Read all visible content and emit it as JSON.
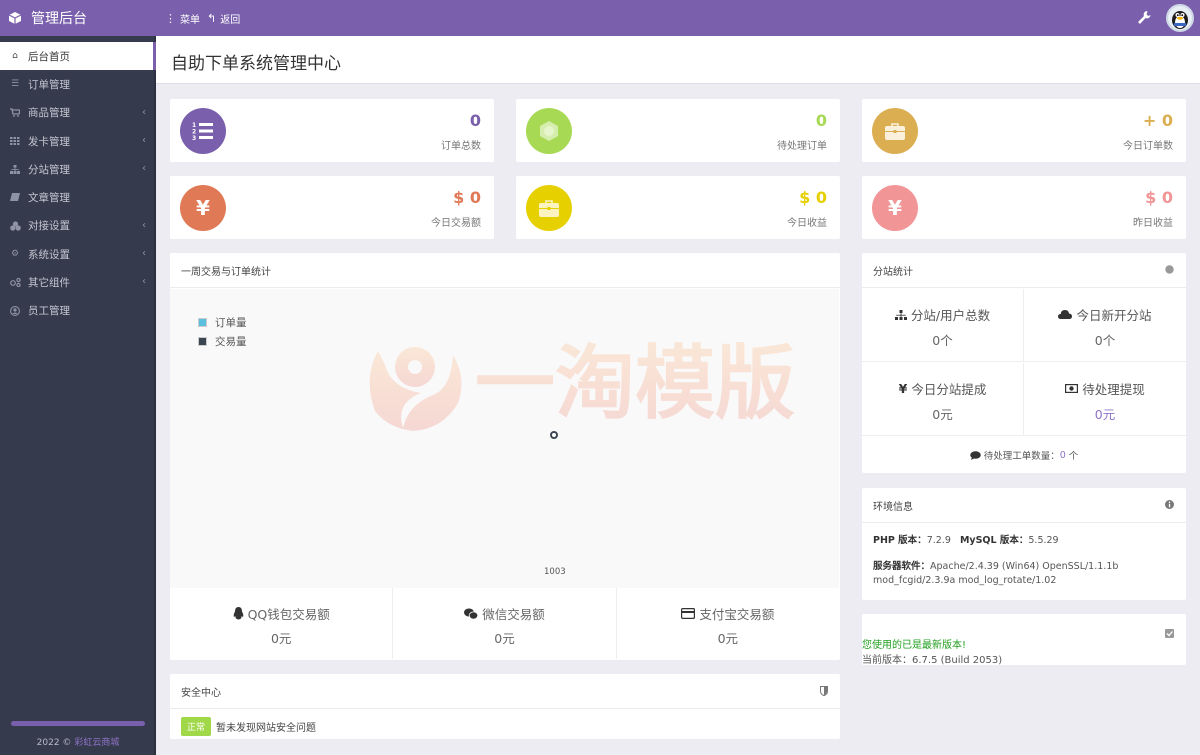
{
  "topbar": {
    "brand": "管理后台",
    "menu_label": "菜单",
    "back_label": "返回"
  },
  "sidebar": {
    "items": [
      {
        "label": "后台首页",
        "icon": "home-icon",
        "submenu": false,
        "active": true
      },
      {
        "label": "订单管理",
        "icon": "list-icon",
        "submenu": false
      },
      {
        "label": "商品管理",
        "icon": "cart-icon",
        "submenu": true
      },
      {
        "label": "发卡管理",
        "icon": "grid-icon",
        "submenu": true
      },
      {
        "label": "分站管理",
        "icon": "sitemap-icon",
        "submenu": true
      },
      {
        "label": "文章管理",
        "icon": "book-icon",
        "submenu": false
      },
      {
        "label": "对接设置",
        "icon": "cubes-icon",
        "submenu": true
      },
      {
        "label": "系统设置",
        "icon": "gear-icon",
        "submenu": true
      },
      {
        "label": "其它组件",
        "icon": "share-nodes-icon",
        "submenu": true
      },
      {
        "label": "员工管理",
        "icon": "user-circle-icon",
        "submenu": false
      }
    ],
    "footer_year": "2022 ©",
    "footer_link": "彩虹云商城"
  },
  "page": {
    "title": "自助下单系统管理中心"
  },
  "stats": [
    {
      "value": "0",
      "label": "订单总数",
      "color": "#7a60ac",
      "icon": "ordered-list-icon"
    },
    {
      "value": "0",
      "label": "待处理订单",
      "color": "#a7d954",
      "icon": "hexagon-icon"
    },
    {
      "value": "+ 0",
      "label": "今日订单数",
      "color": "#dcae52",
      "icon": "briefcase-icon"
    },
    {
      "value": "$ 0",
      "label": "今日交易额",
      "color": "#e07a56",
      "icon": "yen-icon"
    },
    {
      "value": "$ 0",
      "label": "今日收益",
      "color": "#e6d000",
      "icon": "briefcase-icon"
    },
    {
      "value": "$ 0",
      "label": "昨日收益",
      "color": "#f19596",
      "icon": "yen-icon"
    }
  ],
  "weekly_panel": {
    "title": "一周交易与订单统计",
    "legend": [
      {
        "label": "订单量",
        "color": "#5bc0de"
      },
      {
        "label": "交易量",
        "color": "#3c4652"
      }
    ],
    "watermark": "一淘模版",
    "x_tick": "1003"
  },
  "chart_data": {
    "type": "line",
    "title": "一周交易与订单统计",
    "x": [
      "1003"
    ],
    "series": [
      {
        "name": "订单量",
        "values": [
          0
        ]
      },
      {
        "name": "交易量",
        "values": [
          0
        ]
      }
    ],
    "legend": "top-left"
  },
  "payments": [
    {
      "label": "QQ钱包交易额",
      "value": "0元",
      "icon": "qq-penguin-icon"
    },
    {
      "label": "微信交易额",
      "value": "0元",
      "icon": "wechat-icon"
    },
    {
      "label": "支付宝交易额",
      "value": "0元",
      "icon": "credit-card-icon"
    }
  ],
  "security": {
    "title": "安全中心",
    "badge": "正常",
    "message": "暂未发现网站安全问题"
  },
  "substation": {
    "title": "分站统计",
    "cells": [
      {
        "label": "分站/用户总数",
        "value": "0个",
        "icon": "sitemap-icon"
      },
      {
        "label": "今日新开分站",
        "value": "0个",
        "icon": "cloud-icon"
      },
      {
        "label": "今日分站提成",
        "value": "0元",
        "icon": "yen-icon"
      },
      {
        "label": "待处理提现",
        "value": "0元",
        "icon": "money-icon"
      }
    ],
    "ticket_label": "待处理工单数量：",
    "ticket_count": "0",
    "ticket_unit": "个"
  },
  "env": {
    "title": "环境信息",
    "php_label": "PHP 版本：",
    "php_value": "7.2.9",
    "mysql_label": "MySQL 版本：",
    "mysql_value": "5.5.29",
    "server_label": "服务器软件：",
    "server_value": "Apache/2.4.39 (Win64) OpenSSL/1.1.1b mod_fcgid/2.3.9a mod_log_rotate/1.02"
  },
  "version": {
    "latest_msg": "您使用的已是最新版本!",
    "current_label": "当前版本：",
    "current_value": "6.7.5 (Build 2053)"
  }
}
